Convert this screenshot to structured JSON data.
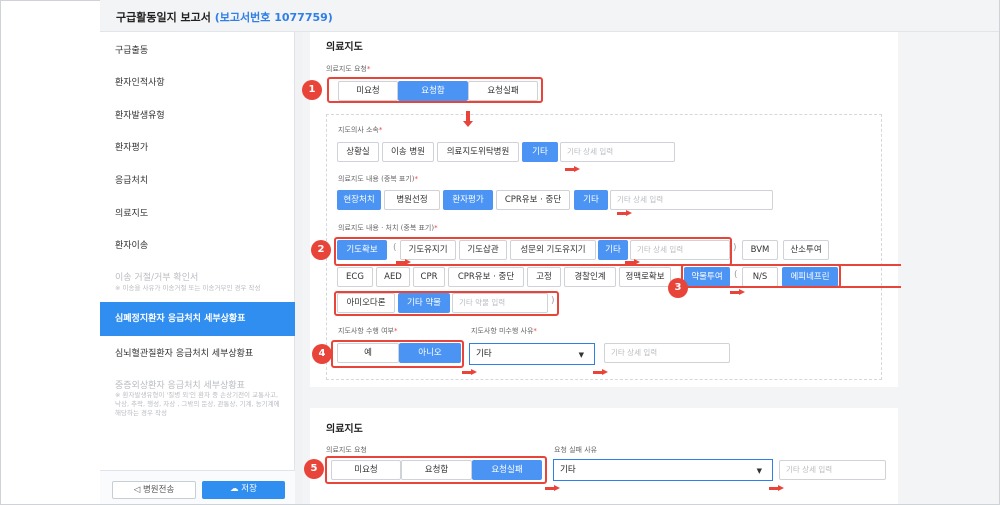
{
  "header": {
    "title": "구급활동일지 보고서",
    "report_no": "(보고서번호 1077759)"
  },
  "sidebar": {
    "items": [
      {
        "label": "구급출동"
      },
      {
        "label": "환자인적사항"
      },
      {
        "label": "환자발생유형"
      },
      {
        "label": "환자평가"
      },
      {
        "label": "응급처치"
      },
      {
        "label": "의료지도"
      },
      {
        "label": "환자이송"
      },
      {
        "label": "이송 거절/거부 확인서"
      },
      {
        "label": "※ 이송을 사유가 이송거절 또는 이송거부인 경우 작성"
      },
      {
        "label": "심폐정지환자 응급처치 세부상황표"
      },
      {
        "label": "심뇌혈관질환자 응급처치 세부상황표"
      },
      {
        "label": "중증외상환자 응급처치 세부상황표"
      },
      {
        "label": "※ 환자발생유형이 '질병 외'인 환자 중 손상기전이 교통사고, 낙상, 추락, 행성, 자상 , 그밖의 둔상, 관통상, 기계, 농기계에 해당하는 경우 작성"
      }
    ],
    "transfer_button": "병원전송",
    "save_button": "저장"
  },
  "section1": {
    "title": "의료지도",
    "request_label": "의료지도 요청",
    "request_options": [
      "미요청",
      "요청함",
      "요청실패"
    ],
    "doctor_label": "지도의사 소속",
    "doctor_options": [
      "상황실",
      "이송 병원",
      "의료지도위탁병원",
      "기타"
    ],
    "doctor_other_placeholder": "기타 상세 입력",
    "content_label": "의료지도 내용 (중복 표기)",
    "content_options": [
      "현장처치",
      "병원선정",
      "환자평가",
      "CPR유보 · 중단",
      "기타"
    ],
    "content_other_placeholder": "기타 상세 입력",
    "treat_label": "의료지도 내용 · 처치 (중복 표기)",
    "airway_options": [
      "기도확보",
      "기도유지기",
      "기도삽관",
      "성문외 기도유지기",
      "기타"
    ],
    "airway_other_placeholder": "기타 상세 입력",
    "row1_extra": [
      "BVM",
      "산소투여"
    ],
    "row2_options": [
      "ECG",
      "AED",
      "CPR",
      "CPR유보 · 중단",
      "고정",
      "경찰인계",
      "정맥로확보"
    ],
    "drug_options": [
      "약물투여",
      "N/S",
      "에피네프린"
    ],
    "row3_options": [
      "아미오다론",
      "기타 약물"
    ],
    "drug_other_placeholder": "기타 약물 입력",
    "perform_label": "지도사항 수행 여부",
    "perform_options": [
      "예",
      "아니오"
    ],
    "reason_label": "지도사항 미수행 사유",
    "reason_value": "기타",
    "reason_other_placeholder": "기타 상세 입력"
  },
  "section2": {
    "title": "의료지도",
    "request_label": "의료지도 요청",
    "request_options": [
      "미요청",
      "요청함",
      "요청실패"
    ],
    "fail_label": "요청 실패 사유",
    "fail_value": "기타",
    "fail_other_placeholder": "기타 상세 입력"
  },
  "annotations": {
    "badges": [
      "1",
      "2",
      "3",
      "4",
      "5"
    ],
    "color": "#e8443a"
  },
  "colors": {
    "accent": "#4b94f3",
    "active_nav": "#2f8ef0",
    "required": "#e8443a"
  },
  "required_mark": "*"
}
